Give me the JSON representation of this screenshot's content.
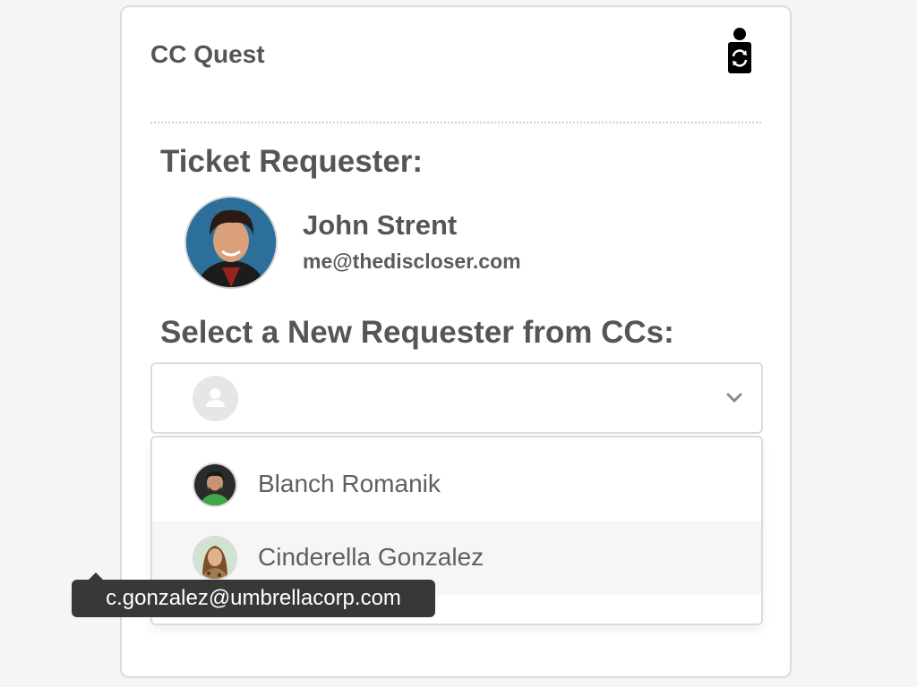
{
  "app": {
    "title": "CC Quest",
    "logo_icon": "person-sync-logo-icon"
  },
  "requester": {
    "section_title": "Ticket Requester:",
    "name": "John Strent",
    "email": "me@thediscloser.com"
  },
  "select": {
    "section_title": "Select a New Requester from CCs:",
    "placeholder_icon": "person-placeholder-icon",
    "chevron_icon": "chevron-down-icon"
  },
  "options": [
    {
      "name": "Blanch Romanik"
    },
    {
      "name": "Cinderella Gonzalez",
      "highlighted": true
    }
  ],
  "tooltip": {
    "text": "c.gonzalez@umbrellacorp.com"
  },
  "colors": {
    "background": "#f5f5f5",
    "text": "#555555",
    "tooltip_bg": "#383838",
    "hover_row": "#f6f6f6"
  }
}
